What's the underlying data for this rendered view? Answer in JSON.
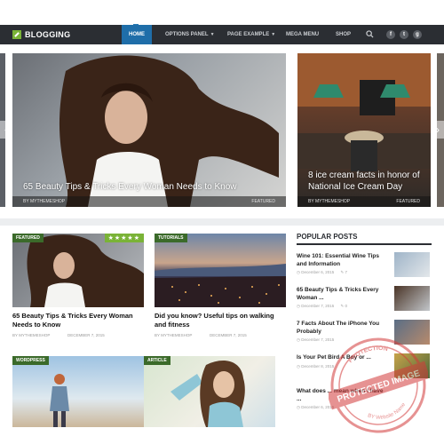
{
  "header": {
    "logo_text": "BLOGGING",
    "nav": [
      {
        "label": "HOME",
        "active": true
      },
      {
        "label": "OPTIONS PANEL",
        "has_menu": true
      },
      {
        "label": "PAGE EXAMPLE",
        "has_menu": true
      },
      {
        "label": "MEGA MENU"
      },
      {
        "label": "SHOP"
      }
    ],
    "search_icon": "search-icon",
    "social": [
      "facebook-icon",
      "twitter-icon",
      "google-plus-icon"
    ],
    "social_glyphs": [
      "f",
      "t",
      "g"
    ],
    "colors": {
      "nav_bg": "#2b2e33",
      "active": "#1f6ea9",
      "brand": "#7ab337"
    }
  },
  "slider": {
    "slides": [
      {
        "title": "65 Beauty Tips & Tricks Every Woman Needs to Know",
        "author": "BY MYTHEMESHOP",
        "label": "FEATURED"
      },
      {
        "title": "8 ice cream facts in honor of National Ice Cream Day",
        "author": "BY MYTHEMESHOP",
        "label": "FEATURED"
      }
    ],
    "prev_glyph": "‹",
    "next_glyph": "›"
  },
  "posts": [
    {
      "tag": "FEATURED",
      "rating": "★★★★★",
      "title": "65 Beauty Tips & Tricks Every Woman Needs to Know",
      "author": "BY MYTHEMESHOP",
      "date": "DECEMBER 7, 2015"
    },
    {
      "tag": "TUTORIALS",
      "title": "Did you know? Useful tips on walking and fitness",
      "author": "BY MYTHEMESHOP",
      "date": "DECEMBER 7, 2015"
    },
    {
      "tag": "WORDPRESS"
    },
    {
      "tag": "ARTICLE"
    }
  ],
  "popular": {
    "heading": "POPULAR POSTS",
    "items": [
      {
        "title": "Wine 101: Essential Wine Tips and Information",
        "date": "December 6, 2015",
        "comments": "7"
      },
      {
        "title": "65 Beauty Tips & Tricks Every Woman ...",
        "date": "December 7, 2015",
        "comments": "0"
      },
      {
        "title": "7 Facts About The iPhone You Probably",
        "date": "December 7, 2015",
        "comments": ""
      },
      {
        "title": "Is Your Pet Bird A Boy or ...",
        "date": "December 8, 2015",
        "comments": ""
      },
      {
        "title": "What does ... mean when I have ...",
        "date": "December 6, 2015",
        "comments": ""
      }
    ]
  },
  "watermark": {
    "text": "PROTECTED IMAGE",
    "ring_top": "PROTECTION",
    "ring_bottom": "BY Website Name"
  }
}
